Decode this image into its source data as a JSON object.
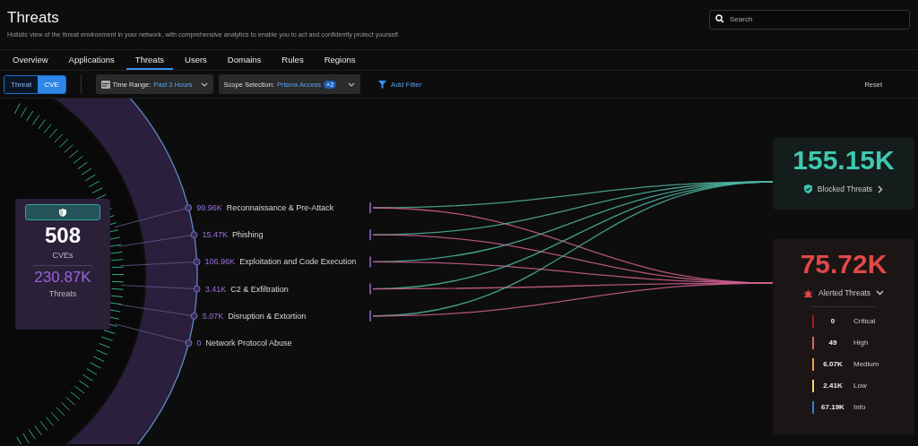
{
  "header": {
    "title": "Threats",
    "subtitle": "Holistic view of the threat environment in your network, with comprehensive analytics to enable you to act and confidently protect yourself.",
    "search": {
      "placeholder": "Search"
    }
  },
  "tabs": [
    {
      "label": "Overview",
      "selected": false
    },
    {
      "label": "Applications",
      "selected": false
    },
    {
      "label": "Threats",
      "selected": true
    },
    {
      "label": "Users",
      "selected": false
    },
    {
      "label": "Domains",
      "selected": false
    },
    {
      "label": "Rules",
      "selected": false
    },
    {
      "label": "Regions",
      "selected": false
    }
  ],
  "toolbar": {
    "toggle": [
      {
        "label": "Threat",
        "selected": false
      },
      {
        "label": "CVE",
        "selected": true
      }
    ],
    "time_range": {
      "label": "Time Range:",
      "value": "Past 3 Hours"
    },
    "scope": {
      "label": "Scope Selection:",
      "value": "Prisma Access",
      "badge": "+2"
    },
    "add_filter": "Add Filter",
    "reset": "Reset"
  },
  "summary": {
    "count": "508",
    "count_label": "CVEs",
    "threats": "230.87K",
    "threats_label": "Threats"
  },
  "categories": [
    {
      "value": "99.96K",
      "label": "Reconnaissance & Pre-Attack"
    },
    {
      "value": "15.47K",
      "label": "Phishing"
    },
    {
      "value": "106.96K",
      "label": "Exploitation and Code Execution"
    },
    {
      "value": "3.41K",
      "label": "C2 & Exfiltration"
    },
    {
      "value": "5.07K",
      "label": "Disruption & Extortion"
    },
    {
      "value": "0",
      "label": "Network Protocol Abuse"
    }
  ],
  "blocked": {
    "value": "155.15K",
    "label": "Blocked Threats"
  },
  "alerted": {
    "value": "75.72K",
    "label": "Alerted Threats",
    "severities": [
      {
        "value": "0",
        "label": "Critical",
        "color": "#b3161b"
      },
      {
        "value": "49",
        "label": "High",
        "color": "#e06464"
      },
      {
        "value": "6.07K",
        "label": "Medium",
        "color": "#eea04a"
      },
      {
        "value": "2.41K",
        "label": "Low",
        "color": "#f3d26a"
      },
      {
        "value": "67.19K",
        "label": "Info",
        "color": "#2f7fe0"
      }
    ]
  }
}
